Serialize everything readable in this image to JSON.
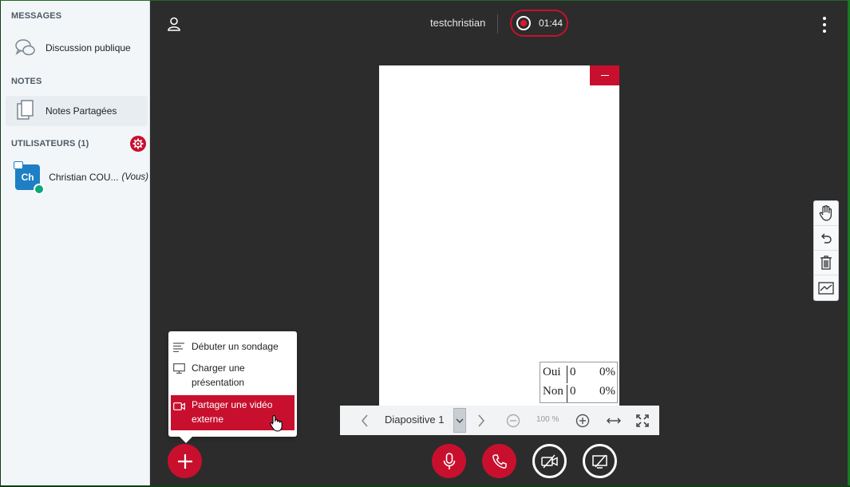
{
  "sidebar": {
    "messages_title": "MESSAGES",
    "public_chat_label": "Discussion publique",
    "notes_title": "NOTES",
    "shared_notes_label": "Notes Partagées",
    "users_title": "UTILISATEURS (1)",
    "user": {
      "initials": "Ch",
      "name": "Christian COU...",
      "you_label": "(Vous)"
    }
  },
  "topbar": {
    "meeting_name": "testchristian",
    "recording_time": "01:44"
  },
  "poll_results": [
    {
      "answer": "Oui",
      "count": "0",
      "percent": "0%"
    },
    {
      "answer": "Non",
      "count": "0",
      "percent": "0%"
    }
  ],
  "slide_toolbar": {
    "slide_label": "Diapositive 1",
    "zoom": "100 %"
  },
  "actions_menu": {
    "items": [
      {
        "label": "Débuter un sondage",
        "icon": "poll-icon"
      },
      {
        "label": "Charger une présentation",
        "icon": "presentation-icon"
      },
      {
        "label": "Partager une vidéo externe",
        "icon": "video-icon"
      }
    ]
  },
  "colors": {
    "accent": "#c8102e",
    "background": "#2c2c2c",
    "sidebar": "#f3f6f9"
  }
}
